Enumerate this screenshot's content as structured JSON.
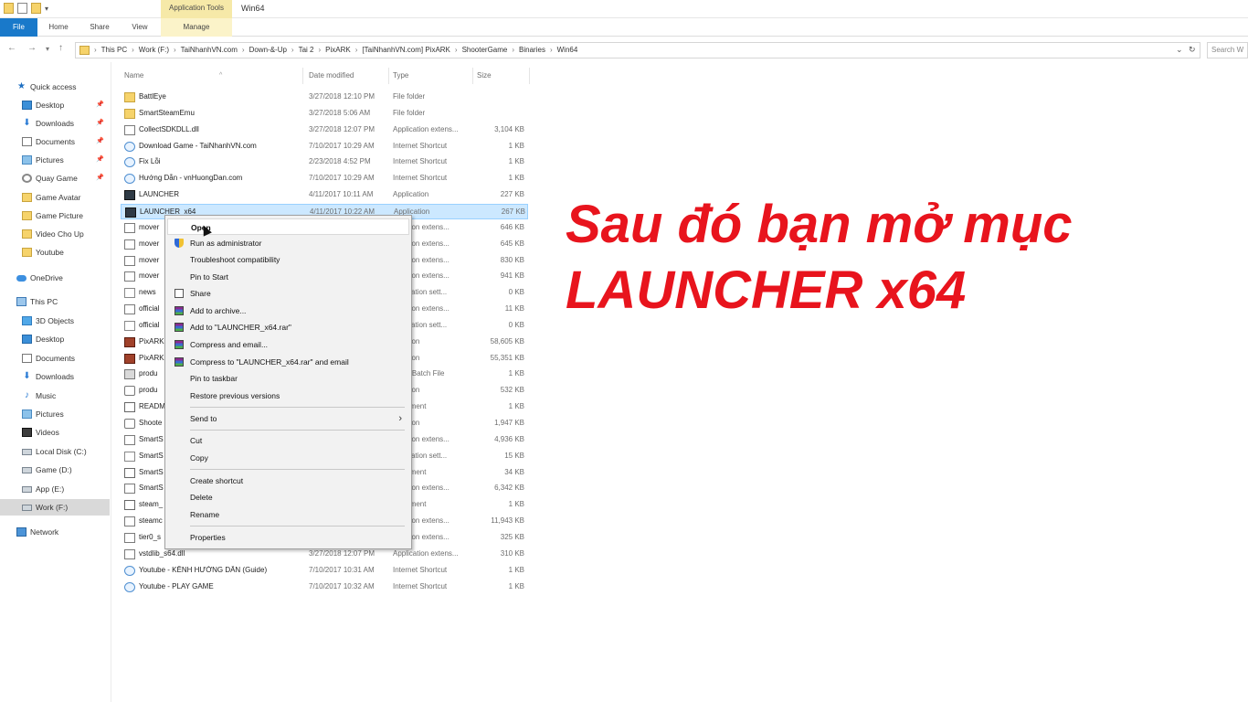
{
  "titlebar": {
    "context_tab_header": "Application Tools",
    "window_title": "Win64"
  },
  "ribbon": {
    "tabs": [
      "File",
      "Home",
      "Share",
      "View",
      "Manage"
    ]
  },
  "address": {
    "crumbs": [
      "This PC",
      "Work (F:)",
      "TaiNhanhVN.com",
      "Down-&-Up",
      "Tai 2",
      "PixARK",
      "[TaiNhanhVN.com] PixARK",
      "ShooterGame",
      "Binaries",
      "Win64"
    ],
    "search_placeholder": "Search W"
  },
  "sidebar": {
    "items": [
      {
        "label": "Quick access",
        "icon": "star-icon"
      },
      {
        "label": "Desktop",
        "icon": "desktop-icon",
        "pinned": true
      },
      {
        "label": "Downloads",
        "icon": "download-icon",
        "pinned": true
      },
      {
        "label": "Documents",
        "icon": "documents-icon",
        "pinned": true
      },
      {
        "label": "Pictures",
        "icon": "pictures-icon",
        "pinned": true
      },
      {
        "label": "Quay Game",
        "icon": "folder-icon",
        "pinned": true
      },
      {
        "label": "Game Avatar",
        "icon": "folder-icon"
      },
      {
        "label": "Game Picture",
        "icon": "folder-icon"
      },
      {
        "label": "Video Cho Up",
        "icon": "folder-icon"
      },
      {
        "label": "Youtube",
        "icon": "folder-icon"
      },
      {
        "label": "OneDrive",
        "icon": "cloud-icon"
      },
      {
        "label": "This PC",
        "icon": "computer-icon"
      },
      {
        "label": "3D Objects",
        "icon": "cube-icon"
      },
      {
        "label": "Desktop",
        "icon": "desktop-icon"
      },
      {
        "label": "Documents",
        "icon": "documents-icon"
      },
      {
        "label": "Downloads",
        "icon": "download-icon"
      },
      {
        "label": "Music",
        "icon": "music-icon"
      },
      {
        "label": "Pictures",
        "icon": "pictures-icon"
      },
      {
        "label": "Videos",
        "icon": "video-icon"
      },
      {
        "label": "Local Disk (C:)",
        "icon": "drive-icon"
      },
      {
        "label": "Game (D:)",
        "icon": "drive-icon"
      },
      {
        "label": "App (E:)",
        "icon": "drive-icon"
      },
      {
        "label": "Work (F:)",
        "icon": "drive-icon",
        "selected": true
      },
      {
        "label": "Network",
        "icon": "network-icon"
      }
    ]
  },
  "columns": {
    "name": "Name",
    "date": "Date modified",
    "type": "Type",
    "size": "Size"
  },
  "files": [
    {
      "name": "BattlEye",
      "date": "3/27/2018 12:10 PM",
      "type": "File folder",
      "size": "",
      "icon": "folder"
    },
    {
      "name": "SmartSteamEmu",
      "date": "3/27/2018 5:06 AM",
      "type": "File folder",
      "size": "",
      "icon": "folder"
    },
    {
      "name": "CollectSDKDLL.dll",
      "date": "3/27/2018 12:07 PM",
      "type": "Application extens...",
      "size": "3,104 KB",
      "icon": "dll"
    },
    {
      "name": "Download Game - TaiNhanhVN.com",
      "date": "7/10/2017 10:29 AM",
      "type": "Internet Shortcut",
      "size": "1 KB",
      "icon": "url"
    },
    {
      "name": "Fix Lỗi",
      "date": "2/23/2018 4:52 PM",
      "type": "Internet Shortcut",
      "size": "1 KB",
      "icon": "url"
    },
    {
      "name": "Hướng Dẫn - vnHuongDan.com",
      "date": "7/10/2017 10:29 AM",
      "type": "Internet Shortcut",
      "size": "1 KB",
      "icon": "url"
    },
    {
      "name": "LAUNCHER",
      "date": "4/11/2017 10:11 AM",
      "type": "Application",
      "size": "227 KB",
      "icon": "app"
    },
    {
      "name": "LAUNCHER_x64",
      "date": "4/11/2017 10:22 AM",
      "type": "Application",
      "size": "267 KB",
      "icon": "app",
      "selected": true
    },
    {
      "name": "mover",
      "date": "",
      "type": "plication extens...",
      "size": "646 KB",
      "icon": "dll"
    },
    {
      "name": "mover",
      "date": "",
      "type": "plication extens...",
      "size": "645 KB",
      "icon": "dll"
    },
    {
      "name": "mover",
      "date": "",
      "type": "plication extens...",
      "size": "830 KB",
      "icon": "dll"
    },
    {
      "name": "mover",
      "date": "",
      "type": "plication extens...",
      "size": "941 KB",
      "icon": "dll"
    },
    {
      "name": "news",
      "date": "",
      "type": "nfiguration sett...",
      "size": "0 KB",
      "icon": "cfg"
    },
    {
      "name": "official",
      "date": "",
      "type": "plication extens...",
      "size": "11 KB",
      "icon": "dll"
    },
    {
      "name": "official",
      "date": "",
      "type": "nfiguration sett...",
      "size": "0 KB",
      "icon": "cfg"
    },
    {
      "name": "PixARK",
      "date": "",
      "type": "plication",
      "size": "58,605 KB",
      "icon": "ark"
    },
    {
      "name": "PixARK",
      "date": "",
      "type": "plication",
      "size": "55,351 KB",
      "icon": "ark"
    },
    {
      "name": "produ",
      "date": "",
      "type": "dows Batch File",
      "size": "1 KB",
      "icon": "bat"
    },
    {
      "name": "produ",
      "date": "",
      "type": "plication",
      "size": "532 KB",
      "icon": "gear"
    },
    {
      "name": "READM",
      "date": "",
      "type": "Document",
      "size": "1 KB",
      "icon": "txt"
    },
    {
      "name": "Shoote",
      "date": "",
      "type": "plication",
      "size": "1,947 KB",
      "icon": "gear"
    },
    {
      "name": "SmartS",
      "date": "",
      "type": "plication extens...",
      "size": "4,936 KB",
      "icon": "dll"
    },
    {
      "name": "SmartS",
      "date": "",
      "type": "nfiguration sett...",
      "size": "15 KB",
      "icon": "cfg"
    },
    {
      "name": "SmartS",
      "date": "",
      "type": "Document",
      "size": "34 KB",
      "icon": "txt"
    },
    {
      "name": "SmartS",
      "date": "",
      "type": "plication extens...",
      "size": "6,342 KB",
      "icon": "dll"
    },
    {
      "name": "steam_",
      "date": "",
      "type": "Document",
      "size": "1 KB",
      "icon": "txt"
    },
    {
      "name": "steamc",
      "date": "",
      "type": "plication extens...",
      "size": "11,943 KB",
      "icon": "dll"
    },
    {
      "name": "tier0_s",
      "date": "",
      "type": "plication extens...",
      "size": "325 KB",
      "icon": "dll"
    },
    {
      "name": "vstdlib_s64.dll",
      "date": "3/27/2018 12:07 PM",
      "type": "Application extens...",
      "size": "310 KB",
      "icon": "dll"
    },
    {
      "name": "Youtube - KÊNH HƯỚNG DẪN (Guide)",
      "date": "7/10/2017 10:31 AM",
      "type": "Internet Shortcut",
      "size": "1 KB",
      "icon": "url"
    },
    {
      "name": "Youtube - PLAY GAME",
      "date": "7/10/2017 10:32 AM",
      "type": "Internet Shortcut",
      "size": "1 KB",
      "icon": "url"
    }
  ],
  "context_menu": {
    "items": [
      {
        "label": "Open",
        "hover": true
      },
      {
        "label": "Run as administrator",
        "icon": "shield-icon"
      },
      {
        "label": "Troubleshoot compatibility"
      },
      {
        "label": "Pin to Start"
      },
      {
        "label": "Share",
        "icon": "share-icon"
      },
      {
        "label": "Add to archive...",
        "icon": "winrar-icon"
      },
      {
        "label": "Add to \"LAUNCHER_x64.rar\"",
        "icon": "winrar-icon"
      },
      {
        "label": "Compress and email...",
        "icon": "winrar-icon"
      },
      {
        "label": "Compress to \"LAUNCHER_x64.rar\" and email",
        "icon": "winrar-icon"
      },
      {
        "label": "Pin to taskbar"
      },
      {
        "label": "Restore previous versions"
      },
      {
        "label": "Send to",
        "submenu": true
      },
      {
        "label": "Cut"
      },
      {
        "label": "Copy"
      },
      {
        "label": "Create shortcut"
      },
      {
        "label": "Delete"
      },
      {
        "label": "Rename"
      },
      {
        "label": "Properties"
      }
    ]
  },
  "overlay": {
    "line1": "Sau đó bạn mở mục",
    "line2": "LAUNCHER x64",
    "color": "#e8141d"
  }
}
